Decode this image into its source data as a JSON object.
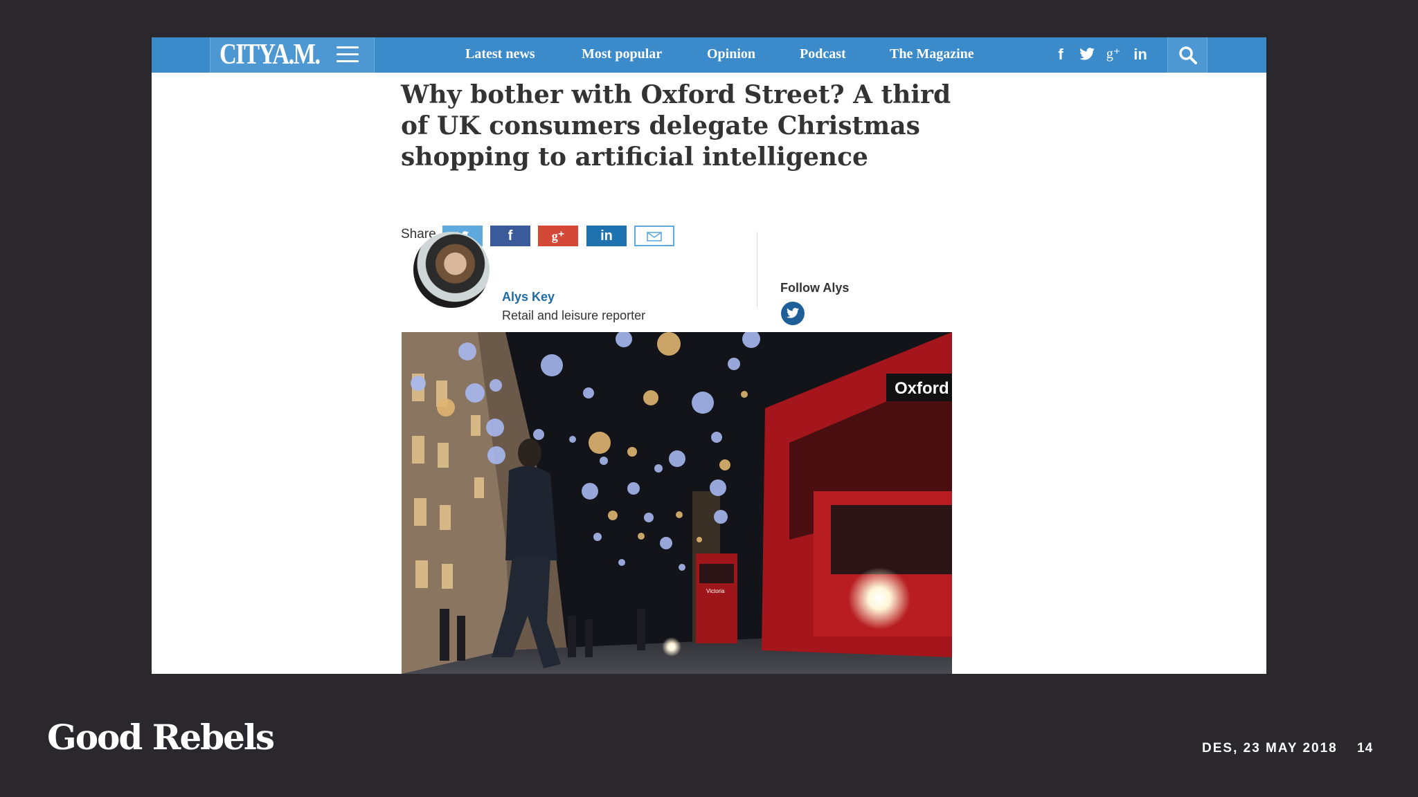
{
  "nav": {
    "logo": "CITYA.M.",
    "links": [
      "Latest news",
      "Most popular",
      "Opinion",
      "Podcast",
      "The Magazine"
    ],
    "social_icons": [
      "facebook-icon",
      "twitter-icon",
      "google-plus-icon",
      "linkedin-icon"
    ],
    "social_glyphs": [
      "f",
      "g⁺",
      "in"
    ],
    "search_icon": "search-icon",
    "colors": {
      "bar": "#3b8bcb",
      "logo_box": "#4d98d3"
    }
  },
  "article": {
    "headline": "Why bother with Oxford Street? A third of UK consumers delegate Christmas shopping to artificial intelligence",
    "share_label": "Share",
    "share_buttons": [
      "twitter",
      "facebook",
      "google-plus",
      "linkedin",
      "email"
    ],
    "share_glyphs": {
      "facebook": "f",
      "google_plus": "g⁺",
      "linkedin": "in"
    },
    "author": {
      "name": "Alys Key",
      "role": "Retail and leisure reporter",
      "follow_label": "Follow Alys"
    },
    "photo": {
      "bus_sign": "Oxford",
      "small_bus_sign": "Victoria"
    }
  },
  "slide": {
    "brand": "Good Rebels",
    "date": "DES, 23 MAY 2018",
    "page": "14"
  }
}
